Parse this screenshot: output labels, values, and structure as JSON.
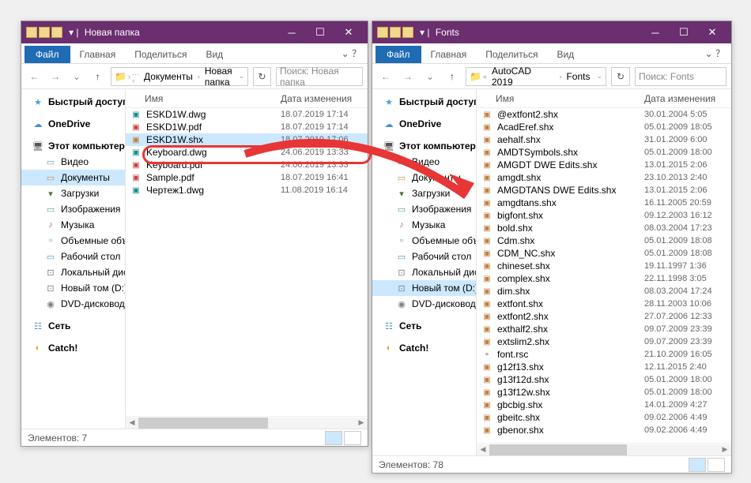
{
  "win1": {
    "title": "Новая папка",
    "fileTab": "Файл",
    "tabs": [
      "Главная",
      "Поделиться",
      "Вид"
    ],
    "path": [
      "Документы",
      "Новая папка"
    ],
    "searchPlaceholder": "Поиск: Новая папка",
    "cols": {
      "name": "Имя",
      "date": "Дата изменения"
    },
    "sidebar": [
      {
        "icon": "★",
        "cls": "ic-star",
        "label": "Быстрый доступ",
        "bold": true
      },
      {
        "spacer": true
      },
      {
        "icon": "☁",
        "cls": "ic-cloud",
        "label": "OneDrive",
        "bold": true
      },
      {
        "spacer": true
      },
      {
        "icon": "🖥",
        "cls": "ic-pc",
        "label": "Этот компьютер",
        "bold": true
      },
      {
        "icon": "▭",
        "cls": "ic-video",
        "label": "Видео",
        "indent": true
      },
      {
        "icon": "▭",
        "cls": "ic-doc",
        "label": "Документы",
        "indent": true,
        "sel": true
      },
      {
        "icon": "▾",
        "cls": "ic-dl",
        "label": "Загрузки",
        "indent": true
      },
      {
        "icon": "▭",
        "cls": "ic-img",
        "label": "Изображения",
        "indent": true
      },
      {
        "icon": "♪",
        "cls": "ic-music",
        "label": "Музыка",
        "indent": true
      },
      {
        "icon": "▫",
        "cls": "ic-3d",
        "label": "Объемные объект",
        "indent": true
      },
      {
        "icon": "▭",
        "cls": "ic-desk",
        "label": "Рабочий стол",
        "indent": true
      },
      {
        "icon": "⊡",
        "cls": "ic-disk",
        "label": "Локальный диск (C",
        "indent": true
      },
      {
        "icon": "⊡",
        "cls": "ic-disk",
        "label": "Новый том (D:)",
        "indent": true
      },
      {
        "icon": "◉",
        "cls": "ic-disk",
        "label": "DVD-дисковод (E:)",
        "indent": true
      },
      {
        "spacer": true
      },
      {
        "icon": "☷",
        "cls": "ic-net",
        "label": "Сеть",
        "bold": true
      },
      {
        "spacer": true
      },
      {
        "icon": "◐",
        "cls": "ic-catch",
        "label": "Catch!",
        "bold": true
      }
    ],
    "files": [
      {
        "icon": "▣",
        "cls": "ic-dwg",
        "name": "ESKD1W.dwg",
        "date": "18.07.2019 17:14"
      },
      {
        "icon": "▣",
        "cls": "ic-pdf",
        "name": "ESKD1W.pdf",
        "date": "18.07.2019 17:14"
      },
      {
        "icon": "▣",
        "cls": "ic-shx",
        "name": "ESKD1W.shx",
        "date": "18.07.2019 17:06",
        "sel": true
      },
      {
        "icon": "▣",
        "cls": "ic-dwg",
        "name": "Keyboard.dwg",
        "date": "24.06.2019 13:33"
      },
      {
        "icon": "▣",
        "cls": "ic-pdf",
        "name": "Keyboard.pdf",
        "date": "24.06.2019 13:33"
      },
      {
        "icon": "▣",
        "cls": "ic-pdf",
        "name": "Sample.pdf",
        "date": "18.07.2019 16:41"
      },
      {
        "icon": "▣",
        "cls": "ic-dwg",
        "name": "Чертеж1.dwg",
        "date": "11.08.2019 16:14"
      }
    ],
    "status": "Элементов: 7"
  },
  "win2": {
    "title": "Fonts",
    "fileTab": "Файл",
    "tabs": [
      "Главная",
      "Поделиться",
      "Вид"
    ],
    "path": [
      "AutoCAD 2019",
      "Fonts"
    ],
    "searchPlaceholder": "Поиск: Fonts",
    "cols": {
      "name": "Имя",
      "date": "Дата изменения"
    },
    "sidebar": [
      {
        "icon": "★",
        "cls": "ic-star",
        "label": "Быстрый доступ",
        "bold": true
      },
      {
        "spacer": true
      },
      {
        "icon": "☁",
        "cls": "ic-cloud",
        "label": "OneDrive",
        "bold": true
      },
      {
        "spacer": true
      },
      {
        "icon": "🖥",
        "cls": "ic-pc",
        "label": "Этот компьютер",
        "bold": true
      },
      {
        "icon": "▭",
        "cls": "ic-video",
        "label": "Видео",
        "indent": true
      },
      {
        "icon": "▭",
        "cls": "ic-doc",
        "label": "Документы",
        "indent": true
      },
      {
        "icon": "▾",
        "cls": "ic-dl",
        "label": "Загрузки",
        "indent": true
      },
      {
        "icon": "▭",
        "cls": "ic-img",
        "label": "Изображения",
        "indent": true
      },
      {
        "icon": "♪",
        "cls": "ic-music",
        "label": "Музыка",
        "indent": true
      },
      {
        "icon": "▫",
        "cls": "ic-3d",
        "label": "Объемные объект",
        "indent": true
      },
      {
        "icon": "▭",
        "cls": "ic-desk",
        "label": "Рабочий стол",
        "indent": true
      },
      {
        "icon": "⊡",
        "cls": "ic-disk",
        "label": "Локальный диск (C",
        "indent": true
      },
      {
        "icon": "⊡",
        "cls": "ic-disk",
        "label": "Новый том (D:)",
        "indent": true,
        "sel": true
      },
      {
        "icon": "◉",
        "cls": "ic-disk",
        "label": "DVD-дисковод (E:)",
        "indent": true
      },
      {
        "spacer": true
      },
      {
        "icon": "☷",
        "cls": "ic-net",
        "label": "Сеть",
        "bold": true
      },
      {
        "spacer": true
      },
      {
        "icon": "◐",
        "cls": "ic-catch",
        "label": "Catch!",
        "bold": true
      }
    ],
    "files": [
      {
        "icon": "▣",
        "cls": "ic-shx",
        "name": "@extfont2.shx",
        "date": "30.01.2004 5:05"
      },
      {
        "icon": "▣",
        "cls": "ic-shx",
        "name": "AcadEref.shx",
        "date": "05.01.2009 18:05"
      },
      {
        "icon": "▣",
        "cls": "ic-shx",
        "name": "aehalf.shx",
        "date": "31.01.2009 6:00"
      },
      {
        "icon": "▣",
        "cls": "ic-shx",
        "name": "AMDTSymbols.shx",
        "date": "05.01.2009 18:00"
      },
      {
        "icon": "▣",
        "cls": "ic-shx",
        "name": "AMGDT DWE Edits.shx",
        "date": "13.01.2015 2:06"
      },
      {
        "icon": "▣",
        "cls": "ic-shx",
        "name": "amgdt.shx",
        "date": "23.10.2013 2:40"
      },
      {
        "icon": "▣",
        "cls": "ic-shx",
        "name": "AMGDTANS DWE Edits.shx",
        "date": "13.01.2015 2:06"
      },
      {
        "icon": "▣",
        "cls": "ic-shx",
        "name": "amgdtans.shx",
        "date": "16.11.2005 20:59"
      },
      {
        "icon": "▣",
        "cls": "ic-shx",
        "name": "bigfont.shx",
        "date": "09.12.2003 16:12"
      },
      {
        "icon": "▣",
        "cls": "ic-shx",
        "name": "bold.shx",
        "date": "08.03.2004 17:23"
      },
      {
        "icon": "▣",
        "cls": "ic-shx",
        "name": "Cdm.shx",
        "date": "05.01.2009 18:08"
      },
      {
        "icon": "▣",
        "cls": "ic-shx",
        "name": "CDM_NC.shx",
        "date": "05.01.2009 18:08"
      },
      {
        "icon": "▣",
        "cls": "ic-shx",
        "name": "chineset.shx",
        "date": "19.11.1997 1:36"
      },
      {
        "icon": "▣",
        "cls": "ic-shx",
        "name": "complex.shx",
        "date": "22.11.1998 3:05"
      },
      {
        "icon": "▣",
        "cls": "ic-shx",
        "name": "dim.shx",
        "date": "08.03.2004 17:24"
      },
      {
        "icon": "▣",
        "cls": "ic-shx",
        "name": "extfont.shx",
        "date": "28.11.2003 10:06"
      },
      {
        "icon": "▣",
        "cls": "ic-shx",
        "name": "extfont2.shx",
        "date": "27.07.2006 12:33"
      },
      {
        "icon": "▣",
        "cls": "ic-shx",
        "name": "exthalf2.shx",
        "date": "09.07.2009 23:39"
      },
      {
        "icon": "▣",
        "cls": "ic-shx",
        "name": "extslim2.shx",
        "date": "09.07.2009 23:39"
      },
      {
        "icon": "▫",
        "cls": "",
        "name": "font.rsc",
        "date": "21.10.2009 16:05"
      },
      {
        "icon": "▣",
        "cls": "ic-shx",
        "name": "g12f13.shx",
        "date": "12.11.2015 2:40"
      },
      {
        "icon": "▣",
        "cls": "ic-shx",
        "name": "g13f12d.shx",
        "date": "05.01.2009 18:00"
      },
      {
        "icon": "▣",
        "cls": "ic-shx",
        "name": "g13f12w.shx",
        "date": "05.01.2009 18:00"
      },
      {
        "icon": "▣",
        "cls": "ic-shx",
        "name": "gbcbig.shx",
        "date": "14.01.2009 4:27"
      },
      {
        "icon": "▣",
        "cls": "ic-shx",
        "name": "gbeitc.shx",
        "date": "09.02.2006 4:49"
      },
      {
        "icon": "▣",
        "cls": "ic-shx",
        "name": "gbenor.shx",
        "date": "09.02.2006 4:49"
      }
    ],
    "status": "Элементов: 78"
  }
}
